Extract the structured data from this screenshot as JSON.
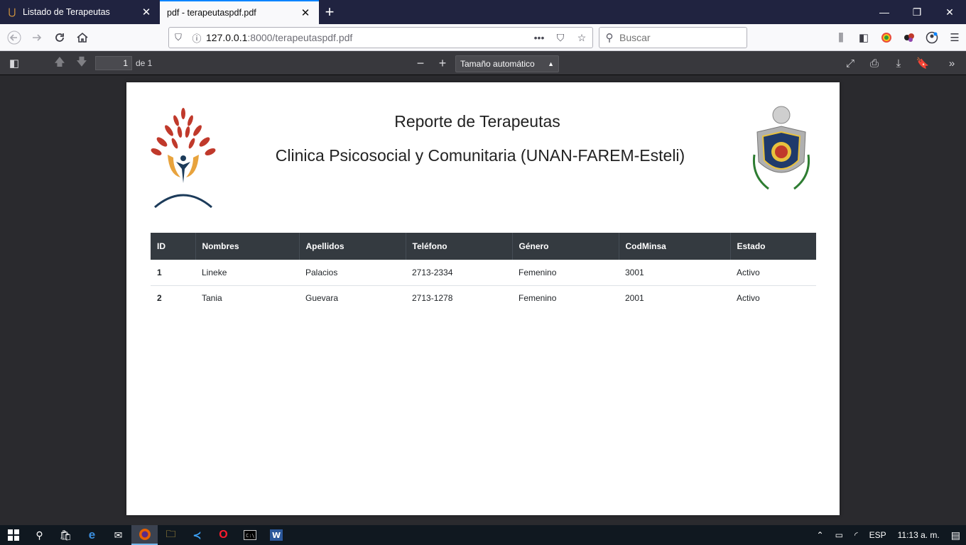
{
  "browser": {
    "tabs": [
      {
        "label": "Listado de Terapeutas",
        "active": false
      },
      {
        "label": "pdf - terapeutaspdf.pdf",
        "active": true
      }
    ],
    "url_host": "127.0.0.1",
    "url_path": ":8000/terapeutaspdf.pdf",
    "search_placeholder": "Buscar"
  },
  "pdf_toolbar": {
    "page_number": "1",
    "page_count": "de 1",
    "zoom_label": "Tamaño automático"
  },
  "report": {
    "title": "Reporte de Terapeutas",
    "subtitle": "Clinica Psicosocial y Comunitaria (UNAN-FAREM-Esteli)",
    "columns": [
      "ID",
      "Nombres",
      "Apellidos",
      "Teléfono",
      "Género",
      "CodMinsa",
      "Estado"
    ],
    "rows": [
      [
        "1",
        "Lineke",
        "Palacios",
        "2713-2334",
        "Femenino",
        "3001",
        "Activo"
      ],
      [
        "2",
        "Tania",
        "Guevara",
        "2713-1278",
        "Femenino",
        "2001",
        "Activo"
      ]
    ]
  },
  "taskbar": {
    "language": "ESP",
    "time": "11:13 a. m."
  },
  "colors": {
    "tabbar": "#202340",
    "accent": "#0a84ff",
    "table_header": "#343a40"
  }
}
